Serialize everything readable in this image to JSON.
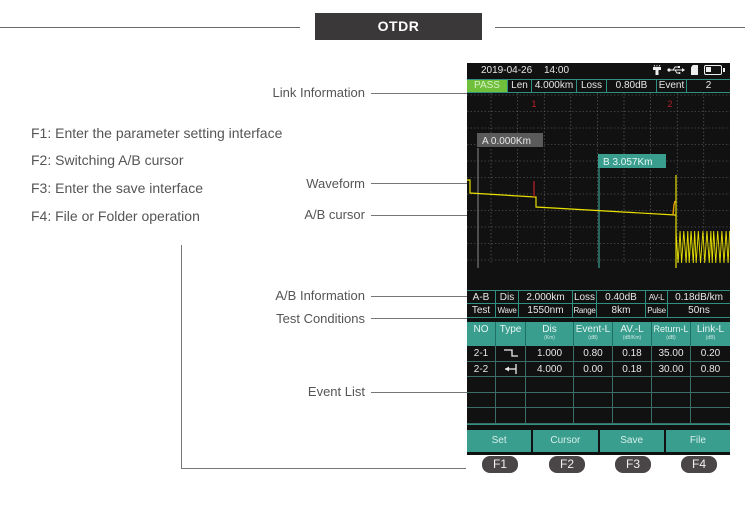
{
  "banner": {
    "title": "OTDR"
  },
  "function_descriptions": [
    "F1: Enter the parameter setting interface",
    "F2: Switching A/B cursor",
    "F3: Enter the save interface",
    "F4: File or Folder operation"
  ],
  "callouts": {
    "link_information": "Link Information",
    "waveform": "Waveform",
    "ab_cursor": "A/B cursor",
    "ab_information": "A/B Information",
    "test_conditions": "Test Conditions",
    "event_list": "Event List"
  },
  "device": {
    "status": {
      "date": "2019-04-26",
      "time": "14:00",
      "icons": [
        "flashlight-icon",
        "usb-icon",
        "sd-card-icon",
        "battery-icon"
      ]
    },
    "link": {
      "result": "PASS",
      "len_label": "Len",
      "len_value": "4.000km",
      "loss_label": "Loss",
      "loss_value": "0.80dB",
      "event_label": "Event",
      "event_value": "2"
    },
    "waveform": {
      "event_markers": [
        "1",
        "2"
      ],
      "cursor_a": {
        "label": "A 0.000Km",
        "position_km": 0.0
      },
      "cursor_b": {
        "label": "B 3.057Km",
        "position_km": 3.057
      },
      "colors": {
        "trace": "#e8e000",
        "grid": "#6a6a6a",
        "cursor_a": "#8a8a8a",
        "cursor_b": "#3a9e8f",
        "event_marker": "#c0202a"
      }
    },
    "ab_info": {
      "label": "A-B",
      "dis_label": "Dis",
      "dis_value": "2.000km",
      "loss_label": "Loss",
      "loss_value": "0.40dB",
      "avl_label": "AV-L",
      "avl_value": "0.18dB/km"
    },
    "test_conditions": {
      "label": "Test",
      "wave_label": "Wave",
      "wave_value": "1550nm",
      "range_label": "Range",
      "range_value": "8km",
      "pulse_label": "Pulse",
      "pulse_value": "50ns"
    },
    "event_table": {
      "columns": [
        {
          "label": "NO",
          "unit": ""
        },
        {
          "label": "Type",
          "unit": ""
        },
        {
          "label": "Dis",
          "unit": "(Km)"
        },
        {
          "label": "Event-L",
          "unit": "(dB)"
        },
        {
          "label": "AV.-L",
          "unit": "(dB/Km)"
        },
        {
          "label": "Return-L",
          "unit": "(dB)"
        },
        {
          "label": "Link-L",
          "unit": "(dB)"
        }
      ],
      "rows": [
        {
          "no": "2-1",
          "type": "reflective-step-icon",
          "dis": "1.000",
          "event_l": "0.80",
          "av_l": "0.18",
          "return_l": "35.00",
          "link_l": "0.20"
        },
        {
          "no": "2-2",
          "type": "end-of-fiber-icon",
          "dis": "4.000",
          "event_l": "0.00",
          "av_l": "0.18",
          "return_l": "30.00",
          "link_l": "0.80"
        }
      ]
    },
    "softkeys": [
      "Set",
      "Cursor",
      "Save",
      "File"
    ],
    "function_keys": [
      "F1",
      "F2",
      "F3",
      "F4"
    ]
  },
  "colors": {
    "teal": "#3a9e8f",
    "pass_green": "#6fbf3a",
    "screen_bg": "#111111",
    "banner_bg": "#3b3839"
  }
}
